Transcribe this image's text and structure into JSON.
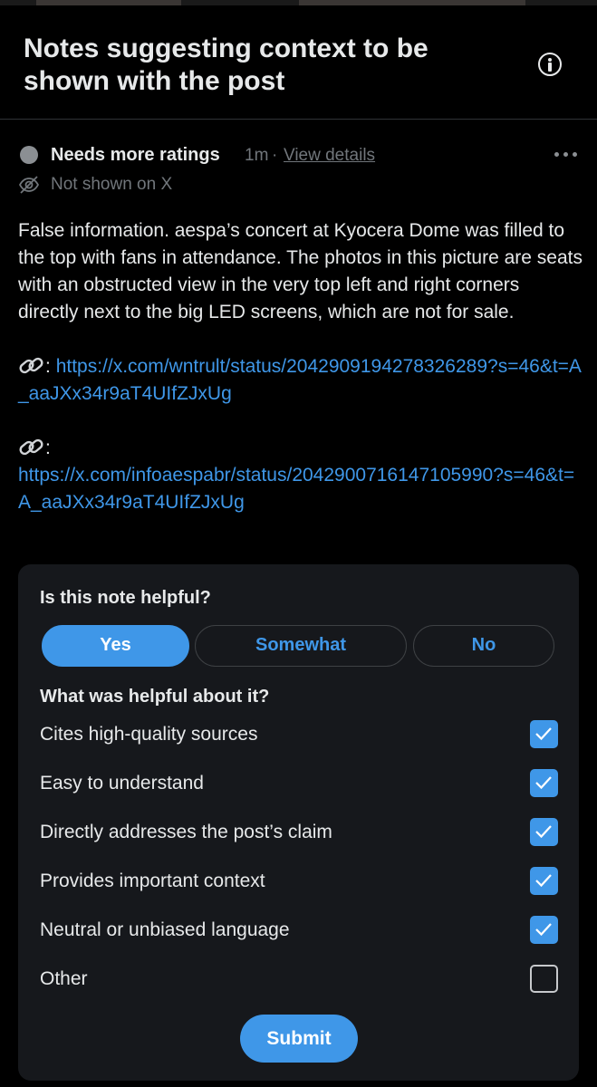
{
  "header": {
    "title": "Notes suggesting context to be shown with the post",
    "info_icon": "info-icon"
  },
  "note": {
    "status_label": "Needs more ratings",
    "time": "1m",
    "separator": "·",
    "view_details": "View details",
    "visibility": "Not shown on X",
    "text": "False information. aespa’s concert at Kyocera Dome was filled to the top with fans in attendance. The photos in this picture are seats with an obstructed view in the very top left and right corners directly next to the big LED screens, which are not for sale.",
    "sources": [
      {
        "icon": "link-icon",
        "prefix": ":",
        "url": "https://x.com/wntrult/status/2042909194278326289?s=46&t=A_aaJXx34r9aT4UIfZJxUg"
      },
      {
        "icon": "link-icon",
        "prefix": ":",
        "url": "https://x.com/infoaespabr/status/2042900716147105990?s=46&t=A_aaJXx34r9aT4UIfZJxUg"
      }
    ]
  },
  "rating": {
    "question": "Is this note helpful?",
    "options": [
      "Yes",
      "Somewhat",
      "No"
    ],
    "selected": "Yes",
    "followup_question": "What was helpful about it?",
    "reasons": [
      {
        "label": "Cites high-quality sources",
        "checked": true
      },
      {
        "label": "Easy to understand",
        "checked": true
      },
      {
        "label": "Directly addresses the post’s claim",
        "checked": true
      },
      {
        "label": "Provides important context",
        "checked": true
      },
      {
        "label": "Neutral or unbiased language",
        "checked": true
      },
      {
        "label": "Other",
        "checked": false
      }
    ],
    "submit_label": "Submit"
  },
  "colors": {
    "background": "#000000",
    "card": "#16181c",
    "accent": "#3f97e8",
    "text_primary": "#e7e9ea",
    "text_secondary": "#71767b"
  }
}
